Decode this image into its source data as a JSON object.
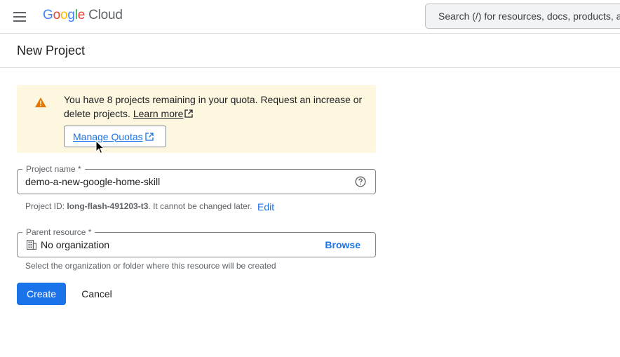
{
  "topbar": {
    "logo_letters": [
      "G",
      "o",
      "o",
      "g",
      "l",
      "e"
    ],
    "logo_product": "Cloud",
    "search_placeholder": "Search (/) for resources, docs, products, and more"
  },
  "page": {
    "title": "New Project"
  },
  "quota_banner": {
    "message": "You have 8 projects remaining in your quota. Request an increase or delete projects.",
    "learn_more": "Learn more",
    "manage_quotas": "Manage Quotas"
  },
  "project_name": {
    "label": "Project name *",
    "value": "demo-a-new-google-home-skill"
  },
  "project_id": {
    "prefix": "Project ID:",
    "id": "long-flash-491203-t3",
    "suffix": ". It cannot be changed later.",
    "edit": "Edit"
  },
  "parent_resource": {
    "label": "Parent resource *",
    "value": "No organization",
    "browse": "Browse",
    "helper": "Select the organization or folder where this resource will be created"
  },
  "actions": {
    "create": "Create",
    "cancel": "Cancel"
  },
  "icons": {
    "menu": "hamburger-menu-icon",
    "warning": "warning-triangle-icon",
    "external": "open-in-new-icon",
    "help": "help-circle-icon",
    "organization": "building-icon",
    "cursor": "mouse-pointer-icon"
  },
  "colors": {
    "accent": "#1a73e8",
    "warning_bg": "#fef7e0",
    "warning_icon": "#e37400"
  }
}
